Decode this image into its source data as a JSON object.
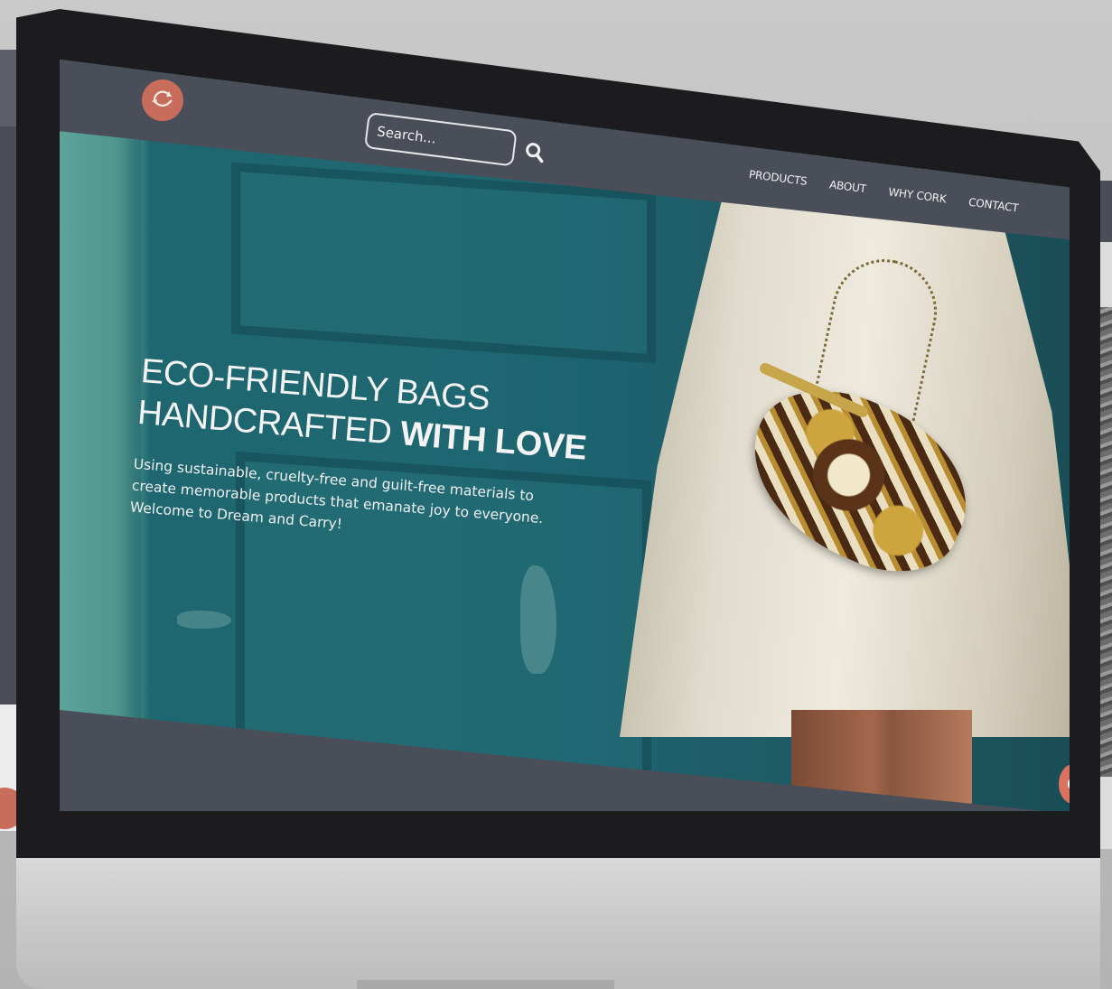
{
  "header": {
    "logo_icon": "recycle-smile-logo",
    "search": {
      "placeholder": "Search..."
    },
    "nav": {
      "items": [
        {
          "label": "PRODUCTS"
        },
        {
          "label": "ABOUT"
        },
        {
          "label": "WHY CORK"
        },
        {
          "label": "CONTACT"
        }
      ]
    }
  },
  "hero": {
    "line1": "ECO-FRIENDLY BAGS",
    "line2_light": "HANDCRAFTED",
    "line2_bold": "WITH LOVE",
    "subtitle": "Using sustainable, cruelty-free and guilt-free materials to create memorable products that emanate joy to everyone. Welcome to Dream and Carry!"
  },
  "widgets": {
    "messenger_icon": "messenger-chat-icon"
  },
  "colors": {
    "accent": "#c86c5c",
    "header_bg": "#4a4e59",
    "hero_teal": "#1f6872",
    "text_light": "#f3f3f3"
  }
}
